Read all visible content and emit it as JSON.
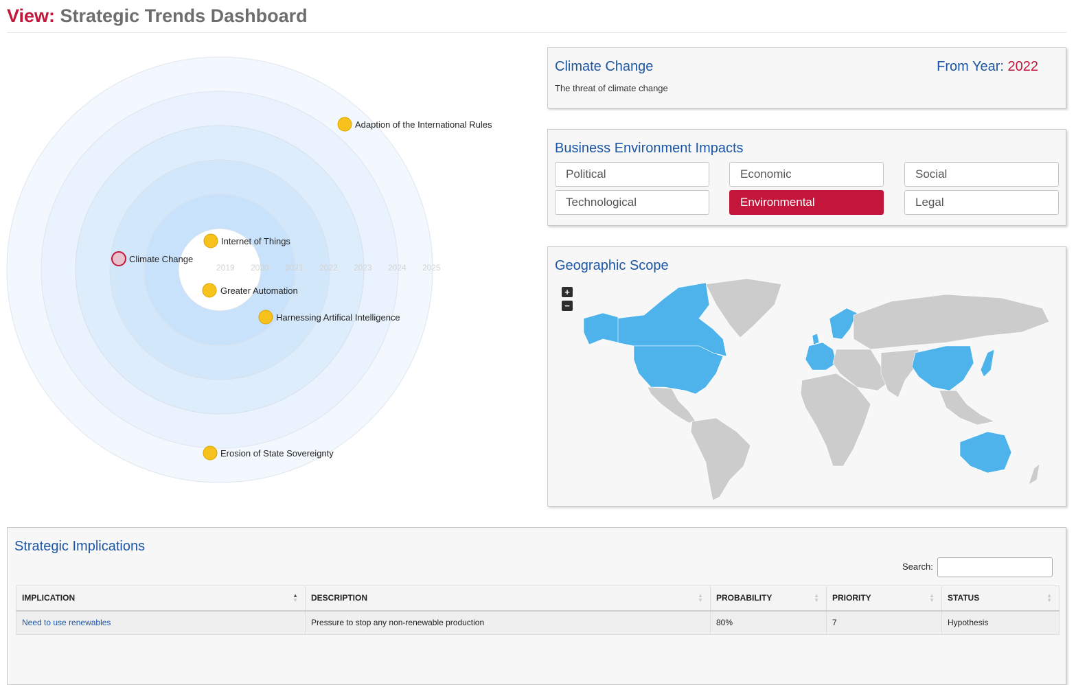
{
  "header": {
    "view_label": "View:",
    "title": "Strategic Trends Dashboard"
  },
  "radar": {
    "year_ticks": [
      "2019",
      "2020",
      "2021",
      "2022",
      "2023",
      "2024",
      "2025"
    ],
    "trends": [
      {
        "label": "Adaption of the International Rules",
        "selected": false
      },
      {
        "label": "Internet of Things",
        "selected": false
      },
      {
        "label": "Climate Change",
        "selected": true
      },
      {
        "label": "Greater Automation",
        "selected": false
      },
      {
        "label": "Harnessing Artifical Intelligence",
        "selected": false
      },
      {
        "label": "Erosion of State Sovereignty",
        "selected": false
      }
    ],
    "colors": {
      "dot": "#f6c21b",
      "dot_stroke": "#d9a400",
      "selected_stroke": "#c4163a"
    }
  },
  "trend": {
    "title": "Climate Change",
    "description": "The threat of climate change",
    "from_year_label": "From Year:",
    "from_year": "2022"
  },
  "impacts": {
    "title": "Business Environment Impacts",
    "items": [
      {
        "label": "Political",
        "active": false
      },
      {
        "label": "Economic",
        "active": false
      },
      {
        "label": "Social",
        "active": false
      },
      {
        "label": "Technological",
        "active": false
      },
      {
        "label": "Environmental",
        "active": true
      },
      {
        "label": "Legal",
        "active": false
      }
    ]
  },
  "geo": {
    "title": "Geographic Scope",
    "zoom_in": "+",
    "zoom_out": "−",
    "highlight_color": "#4db3ea",
    "land_color": "#cccccc"
  },
  "implications": {
    "title": "Strategic Implications",
    "search_label": "Search:",
    "search_value": "",
    "columns": [
      "IMPLICATION",
      "DESCRIPTION",
      "PROBABILITY",
      "PRIORITY",
      "STATUS"
    ],
    "rows": [
      {
        "implication": "Need to use renewables",
        "description": "Pressure to stop any non-renewable production",
        "probability": "80%",
        "priority": "7",
        "status": "Hypothesis"
      }
    ]
  }
}
